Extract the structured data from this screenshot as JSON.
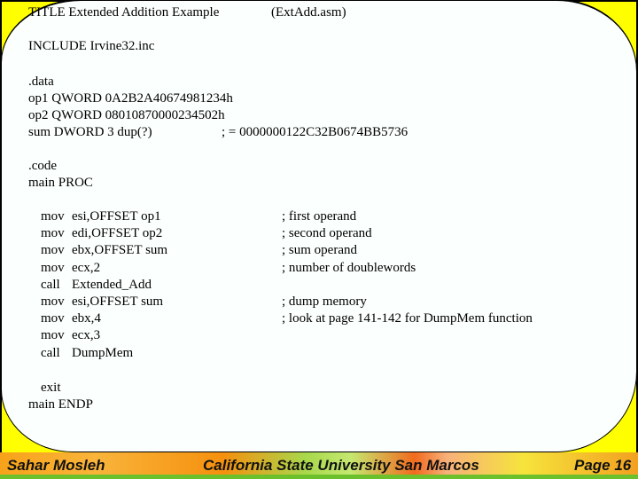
{
  "slide": {
    "title_line": "TITLE Extended Addition Example",
    "title_file": "(ExtAdd.asm)",
    "include_line": "INCLUDE Irvine32.inc",
    "data_section": ".data",
    "data_lines": [
      "op1 QWORD 0A2B2A40674981234h",
      "op2 QWORD 08010870000234502h",
      "sum DWORD 3 dup(?)"
    ],
    "sum_comment": "; = 0000000122C32B0674BB5736",
    "code_section": ".code",
    "proc_start": "main PROC",
    "instructions": [
      {
        "op": "mov",
        "args": "esi,OFFSET op1",
        "comment": "; first operand"
      },
      {
        "op": "mov",
        "args": "edi,OFFSET op2",
        "comment": "; second operand"
      },
      {
        "op": "mov",
        "args": "ebx,OFFSET sum",
        "comment": "; sum operand"
      },
      {
        "op": "mov",
        "args": "ecx,2",
        "comment": "; number of doublewords"
      },
      {
        "op": "call",
        "args": "Extended_Add",
        "comment": ""
      },
      {
        "op": "mov",
        "args": "esi,OFFSET sum",
        "comment": "; dump memory"
      },
      {
        "op": "mov",
        "args": "ebx,4",
        "comment": "; look at page 141-142 for DumpMem function"
      },
      {
        "op": "mov",
        "args": "ecx,3",
        "comment": ""
      },
      {
        "op": "call",
        "args": "DumpMem",
        "comment": ""
      }
    ],
    "exit_line": "exit",
    "proc_end": "main ENDP"
  },
  "footer": {
    "author": "Sahar Mosleh",
    "institution": "California State University San Marcos",
    "page": "Page 16"
  },
  "colors": {
    "corner_accent": "#ffff00",
    "panel_background": "#fbfffd",
    "footer_green": "#6cc02c"
  }
}
